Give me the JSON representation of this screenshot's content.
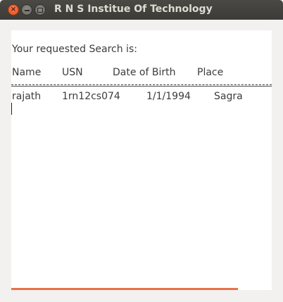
{
  "window": {
    "title": "R N S Institue Of Technology",
    "controls": {
      "close": "×"
    }
  },
  "content": {
    "heading": "Your requested Search is:",
    "columns": [
      "Name",
      "USN",
      "Date of Birth",
      "Place"
    ],
    "rows": [
      [
        "rajath",
        "1rn12cs074",
        "1/1/1994",
        "Sagra"
      ]
    ]
  },
  "progress": {
    "fraction": 0.87,
    "color": "#e9704a"
  }
}
